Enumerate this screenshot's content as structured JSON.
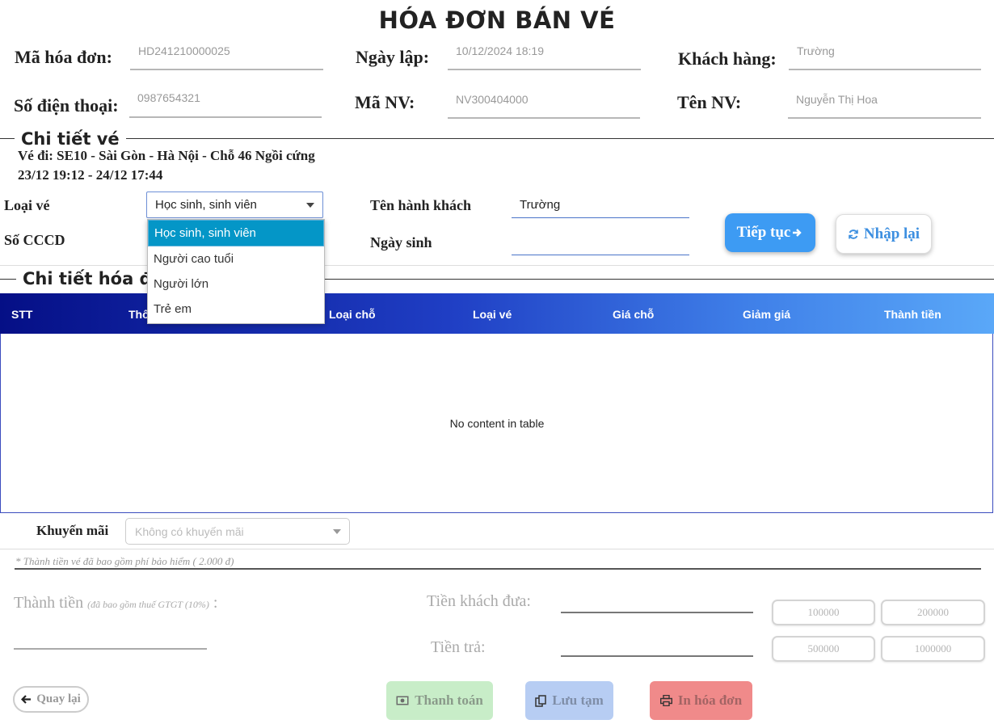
{
  "title": "HÓA ĐƠN BÁN VÉ",
  "invoice": {
    "ma_hoa_don_label": "Mã hóa đơn:",
    "ma_hoa_don": "HD241210000025",
    "ngay_lap_label": "Ngày lập:",
    "ngay_lap": "10/12/2024 18:19",
    "khach_hang_label": "Khách hàng:",
    "khach_hang": "Trường",
    "so_dien_thoai_label": "Số điện thoại:",
    "so_dien_thoai": "0987654321",
    "ma_nv_label": "Mã NV:",
    "ma_nv": "NV300404000",
    "ten_nv_label": "Tên NV:",
    "ten_nv": "Nguyễn Thị Hoa"
  },
  "ticket": {
    "section_title": "Chi tiết vé",
    "line1": "Vé đi: SE10 - Sài Gòn - Hà Nội - Chỗ 46 Ngồi cứng",
    "line2": "23/12 19:12 - 24/12 17:44",
    "loai_ve_label": "Loại vé",
    "loai_ve_value": "Học sinh, sinh viên",
    "so_cccd_label": "Số CCCD",
    "ten_hanh_khach_label": "Tên hành khách",
    "ten_hanh_khach": "Trường",
    "ngay_sinh_label": "Ngày sinh",
    "ngay_sinh": "",
    "dropdown_options": [
      "Học sinh, sinh viên",
      "Người cao tuổi",
      "Người lớn",
      "Trẻ em"
    ],
    "tiep_tuc_label": "Tiếp tục",
    "nhap_lai_label": "Nhập lại"
  },
  "invoice_detail": {
    "section_title": "Chi tiết hóa đơn",
    "columns": [
      "STT",
      "Thông tin vé",
      "Loại chỗ",
      "Loại vé",
      "Giá chỗ",
      "Giảm giá",
      "Thành tiền"
    ],
    "empty_text": "No content in table"
  },
  "promo": {
    "label": "Khuyến mãi",
    "placeholder": "Không có khuyến mãi"
  },
  "note": "* Thành tiền vé đã bao gồm phí bảo hiểm ( 2.000 đ)",
  "payment": {
    "thanh_tien_label": "Thành tiền",
    "thanh_tien_note": "(đã bao gồm thuế GTGT (10%)",
    "thanh_tien_colon": ":",
    "tien_khach_dua_label": "Tiền khách đưa:",
    "tien_tra_label": "Tiền trả:",
    "quick_amounts": [
      "100000",
      "200000",
      "500000",
      "1000000"
    ]
  },
  "actions": {
    "quay_lai": "Quay lại",
    "thanh_toan": "Thanh toán",
    "luu_tam": "Lưu tạm",
    "in_hoa_don": "In hóa đơn"
  },
  "colors": {
    "accent_blue": "#3d9bf3",
    "selected_option": "#0496c7",
    "pay_green": "#c8edc8",
    "save_blue": "#b7cdf3",
    "print_red": "#f08a8a"
  }
}
